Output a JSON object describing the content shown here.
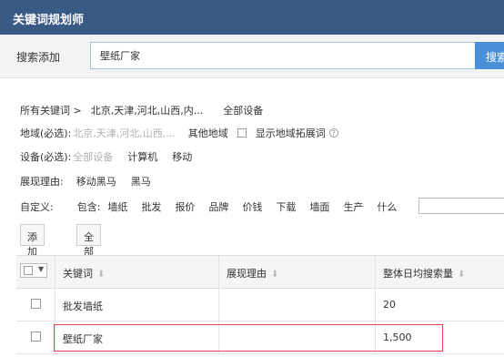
{
  "app": {
    "title": "关键词规划师"
  },
  "search": {
    "label": "搜索添加",
    "value": "壁纸厂家",
    "button_label": "搜索"
  },
  "breadcrumb": {
    "root": "所有关键词 >",
    "region": "北京,天津,河北,山西,内...",
    "device": "全部设备"
  },
  "region_filter": {
    "label": "地域(必选):",
    "value": "北京,天津,河北,山西,...",
    "other": "其他地域",
    "checkbox_label": "显示地域拓展词"
  },
  "device_filter": {
    "label": "设备(必选):",
    "options": [
      "全部设备",
      "计算机",
      "移动"
    ]
  },
  "reason_filter": {
    "label": "展现理由:",
    "options": [
      "移动黑马",
      "黑马"
    ]
  },
  "custom_filter": {
    "label": "自定义:",
    "include": "包含:",
    "words": [
      "墙纸",
      "批发",
      "报价",
      "品牌",
      "价钱",
      "下载",
      "墙面",
      "生产",
      "什么"
    ]
  },
  "actions": {
    "add": "添加",
    "download_all": "全部下载"
  },
  "table": {
    "headers": [
      "关键词",
      "展现理由",
      "整体日均搜索量"
    ],
    "rows": [
      {
        "keyword": "批发墙纸",
        "reason": "",
        "volume": "20"
      },
      {
        "keyword": "壁纸厂家",
        "reason": "",
        "volume": "1,500"
      }
    ]
  },
  "colors": {
    "titlebar": "#3a5a86",
    "accent": "#4a90d9",
    "highlight": "#e0454d"
  }
}
